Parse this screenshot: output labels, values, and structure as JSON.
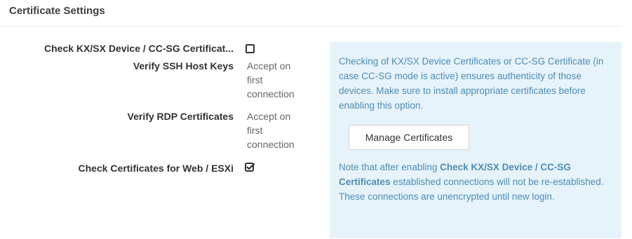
{
  "section": {
    "title": "Certificate Settings"
  },
  "settings": [
    {
      "label": "Check KX/SX Device / CC-SG Certificat...",
      "type": "checkbox",
      "checked": false
    },
    {
      "label": "Verify SSH Host Keys",
      "type": "select",
      "value": "Accept on first connection"
    },
    {
      "label": "Verify RDP Certificates",
      "type": "select",
      "value": "Accept on first connection"
    },
    {
      "label": "Check Certificates for Web / ESXi",
      "type": "checkbox",
      "checked": true
    }
  ],
  "info": {
    "text_1": "Checking of KX/SX Device Certificates or CC-SG Certificate (in case CC-SG mode is active) ensures authenticity of those devices. Make sure to install appropriate certificates before enabling this option.",
    "manage_button_label": "Manage Certificates",
    "note_prefix": "Note that after enabling ",
    "note_bold": "Check KX/SX Device / CC-SG Certificates",
    "note_suffix": " established connections will not be re-established. These connections are unencrypted until new login."
  },
  "colors": {
    "info_bg": "#e6f3fb",
    "info_text": "#4f8cb3",
    "label_text": "#333333",
    "value_text": "#666666"
  }
}
